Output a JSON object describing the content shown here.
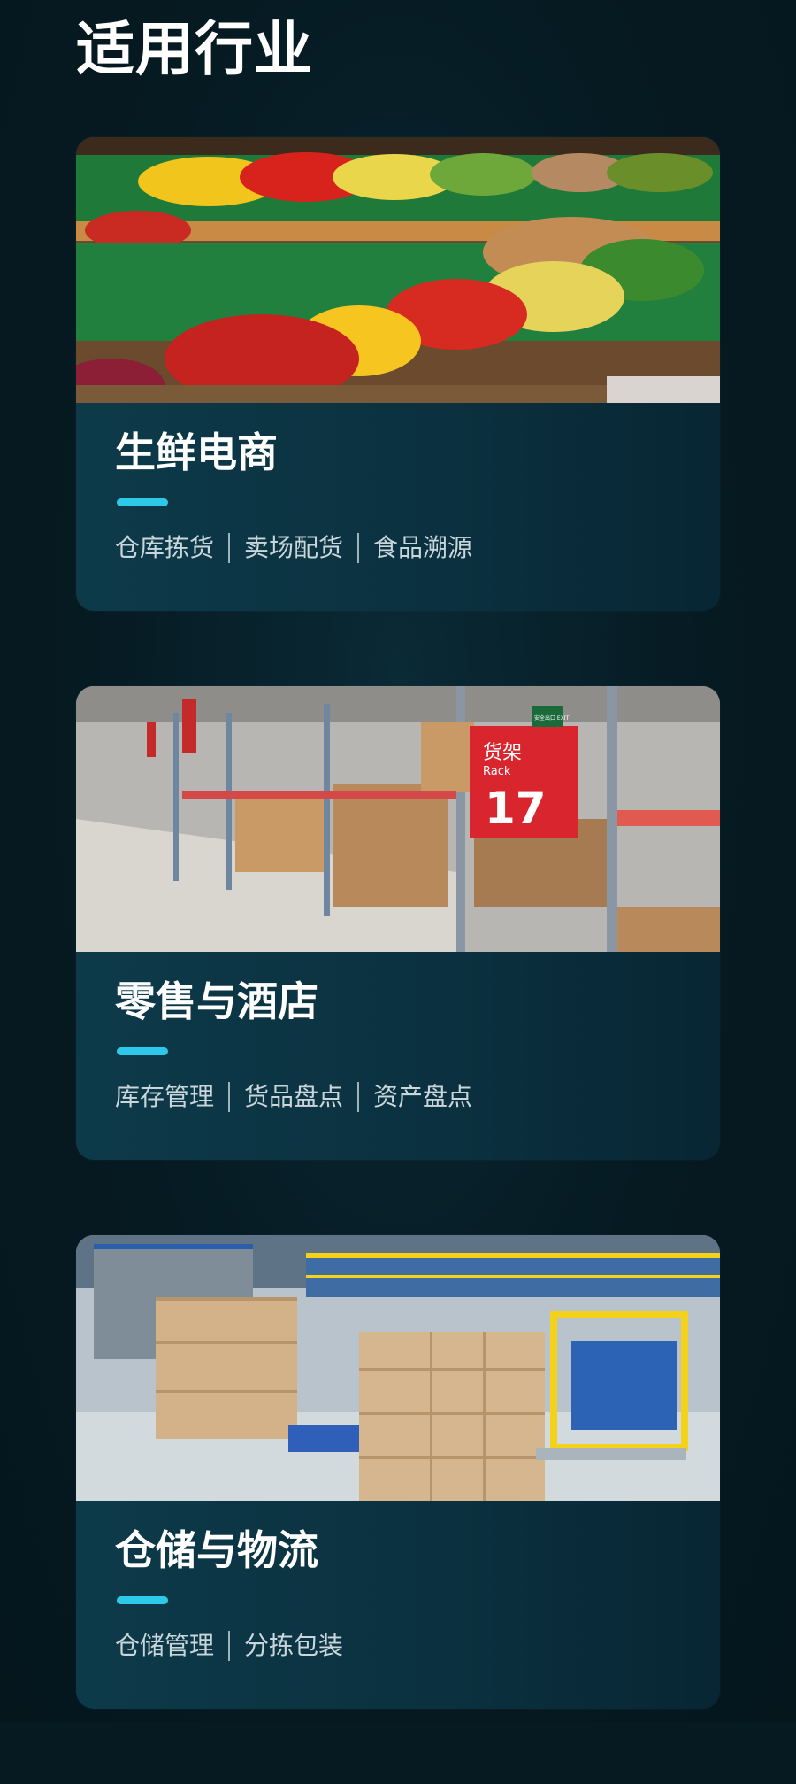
{
  "section": {
    "title": "适用行业"
  },
  "cards": [
    {
      "title": "生鲜电商",
      "tags": [
        "仓库拣货",
        "卖场配货",
        "食品溯源"
      ]
    },
    {
      "title": "零售与酒店",
      "tags": [
        "库存管理",
        "货品盘点",
        "资产盘点"
      ],
      "image_text": {
        "rack_cn": "货架",
        "rack_en": "Rack",
        "rack_no": "17",
        "exit_sign": "安全出口 EXIT"
      }
    },
    {
      "title": "仓储与物流",
      "tags": [
        "仓储管理",
        "分拣包装"
      ]
    }
  ],
  "colors": {
    "background": "#061a22",
    "card": "#0b3140",
    "accent": "#2ec9e8",
    "tag_text": "#c9d6db"
  }
}
